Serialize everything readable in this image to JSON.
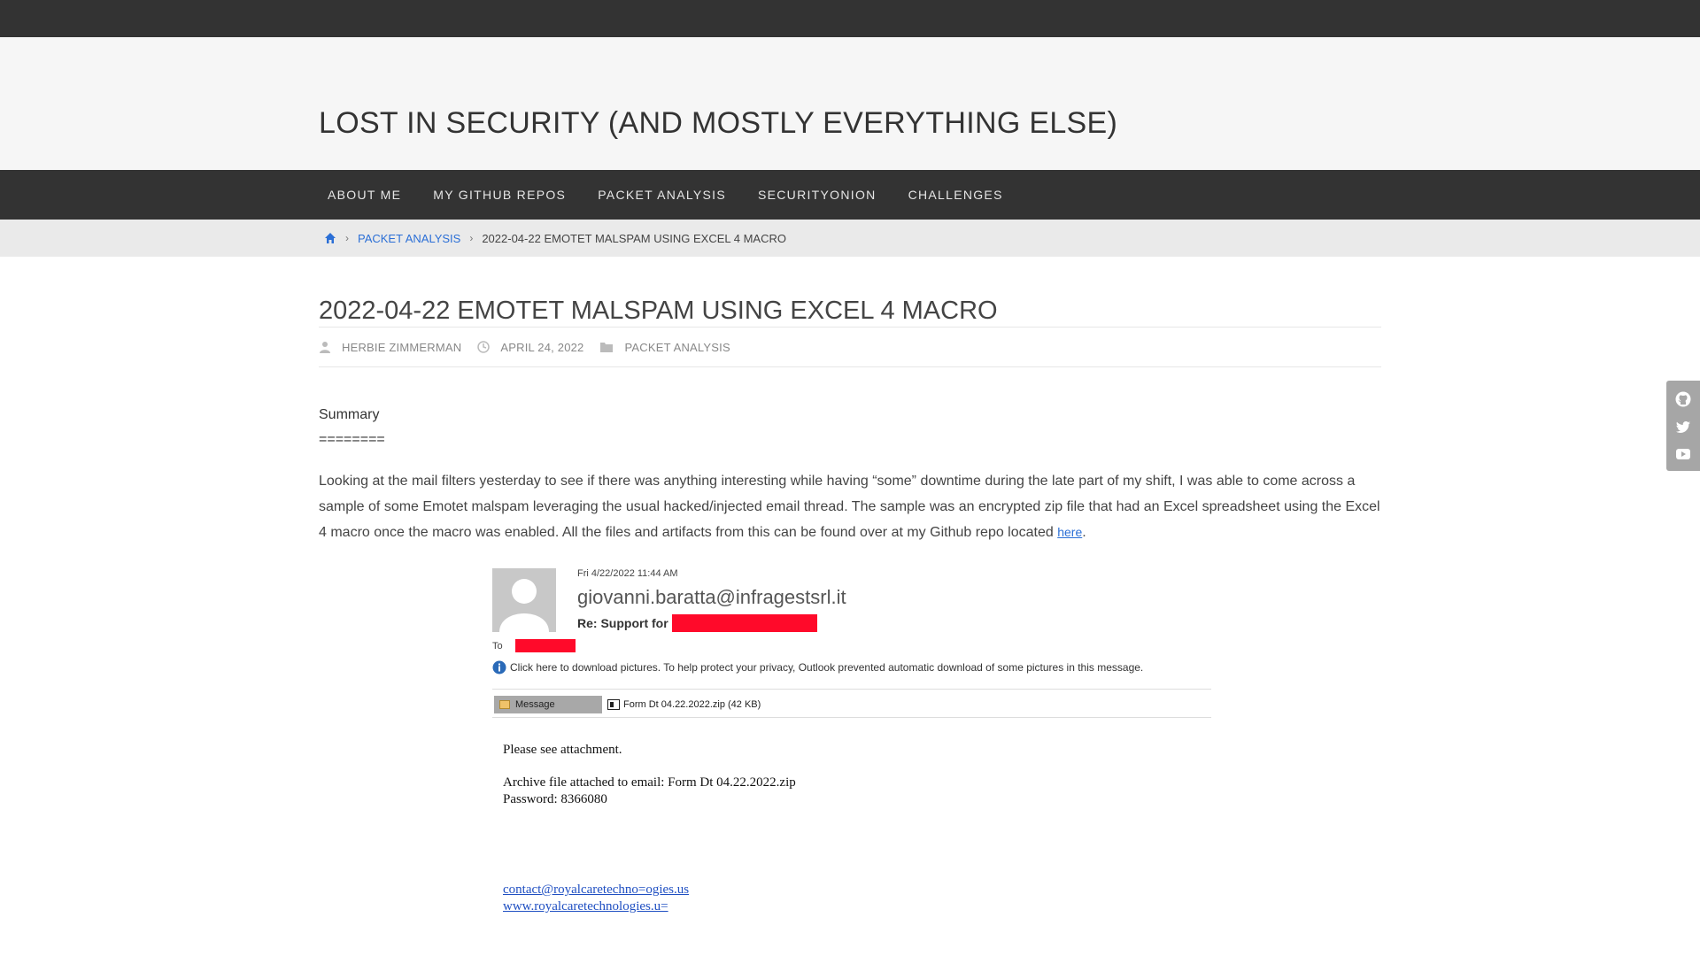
{
  "site": {
    "title": "LOST IN SECURITY (AND MOSTLY EVERYTHING ELSE)"
  },
  "nav": {
    "items": [
      {
        "label": "ABOUT ME"
      },
      {
        "label": "MY GITHUB REPOS"
      },
      {
        "label": "PACKET ANALYSIS"
      },
      {
        "label": "SECURITYONION"
      },
      {
        "label": "CHALLENGES"
      }
    ]
  },
  "breadcrumb": {
    "home_icon": "home-icon",
    "category": "PACKET ANALYSIS",
    "current": "2022-04-22 EMOTET MALSPAM USING EXCEL 4 MACRO"
  },
  "post": {
    "title": "2022-04-22 EMOTET MALSPAM USING EXCEL 4 MACRO",
    "author": "HERBIE ZIMMERMAN",
    "date": "APRIL 24, 2022",
    "category": "PACKET ANALYSIS",
    "summary_heading": "Summary",
    "summary_rule": "========",
    "paragraph": "Looking at the mail filters yesterday to see if there was anything interesting while having “some” downtime during the late part of my shift, I was able to come across a sample of some Emotet malspam leveraging the usual hacked/injected email thread. The sample was an encrypted zip file that had an Excel spreadsheet using the Excel 4 macro once the macro was enabled. All the files and artifacts from this can be found over at my Github repo located ",
    "link_text": "here",
    "paragraph_end": "."
  },
  "email": {
    "date": "Fri 4/22/2022 11:44 AM",
    "from": "giovanni.baratta@infragestsrl.it",
    "subject_prefix": "Re: Support for",
    "to_label": "To",
    "info_text": "Click here to download pictures. To help protect your privacy, Outlook prevented automatic download of some pictures in this message.",
    "message_tab": "Message",
    "attachment": "Form Dt 04.22.2022.zip (42 KB)",
    "body_line1": "Please see attachment.",
    "body_line2": "Archive file attached to email: Form Dt 04.22.2022.zip",
    "body_line3": "Password: 8366080",
    "link1": "contact@royalcaretechno=ogies.us",
    "link2": "www.royalcaretechnologies.u=",
    "redaction_color": "#ff0a2a"
  },
  "social": {
    "icons": [
      "github-icon",
      "twitter-icon",
      "youtube-icon"
    ]
  }
}
